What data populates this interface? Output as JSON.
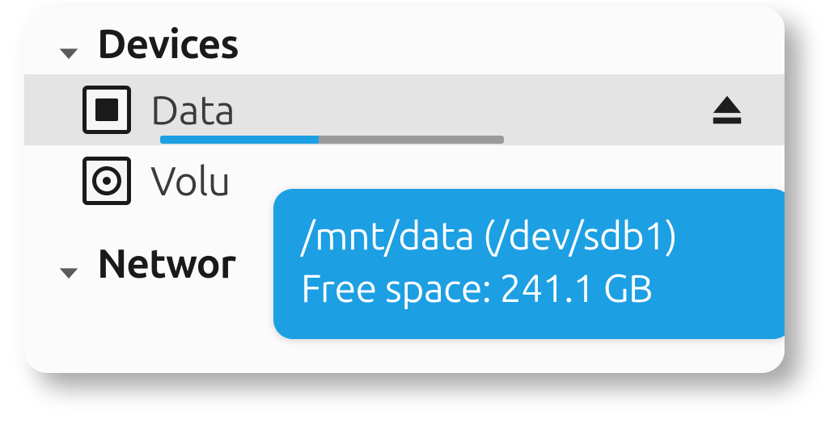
{
  "sidebar": {
    "sections": [
      {
        "title": "Devices",
        "expanded": true,
        "items": [
          {
            "label": "Data",
            "icon": "chip-icon",
            "selected": true,
            "ejectable": true,
            "usage_fraction": 0.46
          },
          {
            "label": "Volu",
            "icon": "disc-icon",
            "selected": false,
            "ejectable": false
          }
        ]
      },
      {
        "title": "Networ",
        "expanded": true,
        "items": []
      }
    ]
  },
  "tooltip": {
    "line1": "/mnt/data (/dev/sdb1)",
    "line2": "Free space: 241.1 GB"
  },
  "colors": {
    "accent": "#1d9fe3",
    "selected_bg": "#e4e4e4"
  }
}
